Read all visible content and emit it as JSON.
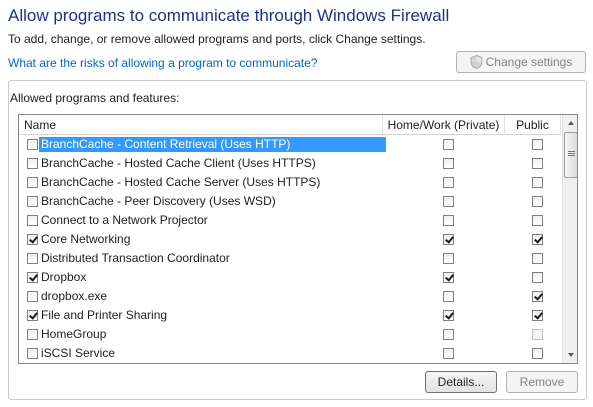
{
  "header": {
    "title": "Allow programs to communicate through Windows Firewall",
    "subtitle": "To add, change, or remove allowed programs and ports, click Change settings.",
    "risk_link": "What are the risks of allowing a program to communicate?",
    "change_settings_label": "Change settings"
  },
  "group": {
    "label": "Allowed programs and features:"
  },
  "list": {
    "columns": {
      "name": "Name",
      "home": "Home/Work (Private)",
      "public": "Public"
    },
    "rows": [
      {
        "name": "BranchCache - Content Retrieval (Uses HTTP)",
        "enabled": false,
        "home": false,
        "public": false,
        "selected": true
      },
      {
        "name": "BranchCache - Hosted Cache Client (Uses HTTPS)",
        "enabled": false,
        "home": false,
        "public": false
      },
      {
        "name": "BranchCache - Hosted Cache Server (Uses HTTPS)",
        "enabled": false,
        "home": false,
        "public": false
      },
      {
        "name": "BranchCache - Peer Discovery (Uses WSD)",
        "enabled": false,
        "home": false,
        "public": false
      },
      {
        "name": "Connect to a Network Projector",
        "enabled": false,
        "home": false,
        "public": false
      },
      {
        "name": "Core Networking",
        "enabled": true,
        "home": true,
        "public": true
      },
      {
        "name": "Distributed Transaction Coordinator",
        "enabled": false,
        "home": false,
        "public": false
      },
      {
        "name": "Dropbox",
        "enabled": true,
        "home": true,
        "public": false
      },
      {
        "name": "dropbox.exe",
        "enabled": false,
        "home": false,
        "public": true
      },
      {
        "name": "File and Printer Sharing",
        "enabled": true,
        "home": true,
        "public": true
      },
      {
        "name": "HomeGroup",
        "enabled": false,
        "home": false,
        "public": false,
        "public_disabled": true
      },
      {
        "name": "iSCSI Service",
        "enabled": false,
        "home": false,
        "public": false
      }
    ]
  },
  "buttons": {
    "details": "Details...",
    "remove": "Remove"
  },
  "colors": {
    "title": "#1e3287",
    "link": "#0066cc",
    "selection": "#3399ff"
  },
  "icons": {
    "change_settings": "uac-shield-icon"
  }
}
